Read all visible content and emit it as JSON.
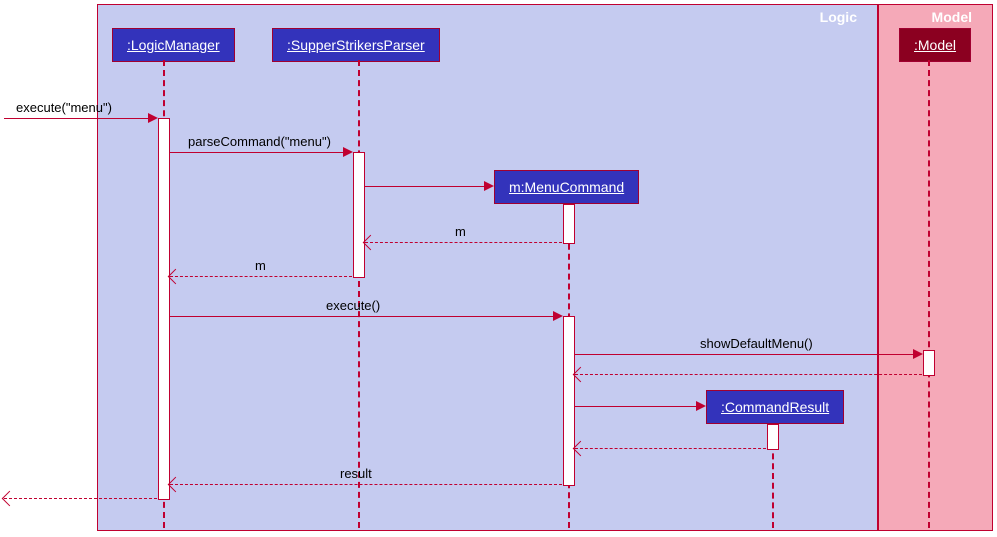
{
  "frames": {
    "logic": {
      "title": "Logic"
    },
    "model": {
      "title": "Model"
    }
  },
  "participants": {
    "logicManager": {
      "label": ":LogicManager"
    },
    "parser": {
      "label": ":SupperStrikersParser"
    },
    "menuCmd": {
      "label": "m:MenuCommand"
    },
    "cmdResult": {
      "label": ":CommandResult"
    },
    "model": {
      "label": ":Model"
    }
  },
  "messages": {
    "execIn": "execute(\"menu\")",
    "parseCmd": "parseCommand(\"menu\")",
    "retM1": "m",
    "retM2": "m",
    "execute": "execute()",
    "showMenu": "showDefaultMenu()",
    "result": "result"
  },
  "chart_data": {
    "type": "sequence-diagram",
    "frames": [
      {
        "name": "Logic",
        "participants": [
          ":LogicManager",
          ":SupperStrikersParser",
          "m:MenuCommand",
          ":CommandResult"
        ]
      },
      {
        "name": "Model",
        "participants": [
          ":Model"
        ]
      }
    ],
    "participants": [
      ":LogicManager",
      ":SupperStrikersParser",
      "m:MenuCommand",
      ":CommandResult",
      ":Model"
    ],
    "messages": [
      {
        "from": "external",
        "to": ":LogicManager",
        "label": "execute(\"menu\")",
        "type": "sync"
      },
      {
        "from": ":LogicManager",
        "to": ":SupperStrikersParser",
        "label": "parseCommand(\"menu\")",
        "type": "sync"
      },
      {
        "from": ":SupperStrikersParser",
        "to": "m:MenuCommand",
        "label": "",
        "type": "create"
      },
      {
        "from": "m:MenuCommand",
        "to": ":SupperStrikersParser",
        "label": "m",
        "type": "return"
      },
      {
        "from": ":SupperStrikersParser",
        "to": ":LogicManager",
        "label": "m",
        "type": "return"
      },
      {
        "from": ":LogicManager",
        "to": "m:MenuCommand",
        "label": "execute()",
        "type": "sync"
      },
      {
        "from": "m:MenuCommand",
        "to": ":Model",
        "label": "showDefaultMenu()",
        "type": "sync"
      },
      {
        "from": ":Model",
        "to": "m:MenuCommand",
        "label": "",
        "type": "return"
      },
      {
        "from": "m:MenuCommand",
        "to": ":CommandResult",
        "label": "",
        "type": "create"
      },
      {
        "from": ":CommandResult",
        "to": "m:MenuCommand",
        "label": "",
        "type": "return"
      },
      {
        "from": "m:MenuCommand",
        "to": ":LogicManager",
        "label": "result",
        "type": "return"
      },
      {
        "from": ":LogicManager",
        "to": "external",
        "label": "",
        "type": "return"
      }
    ]
  }
}
